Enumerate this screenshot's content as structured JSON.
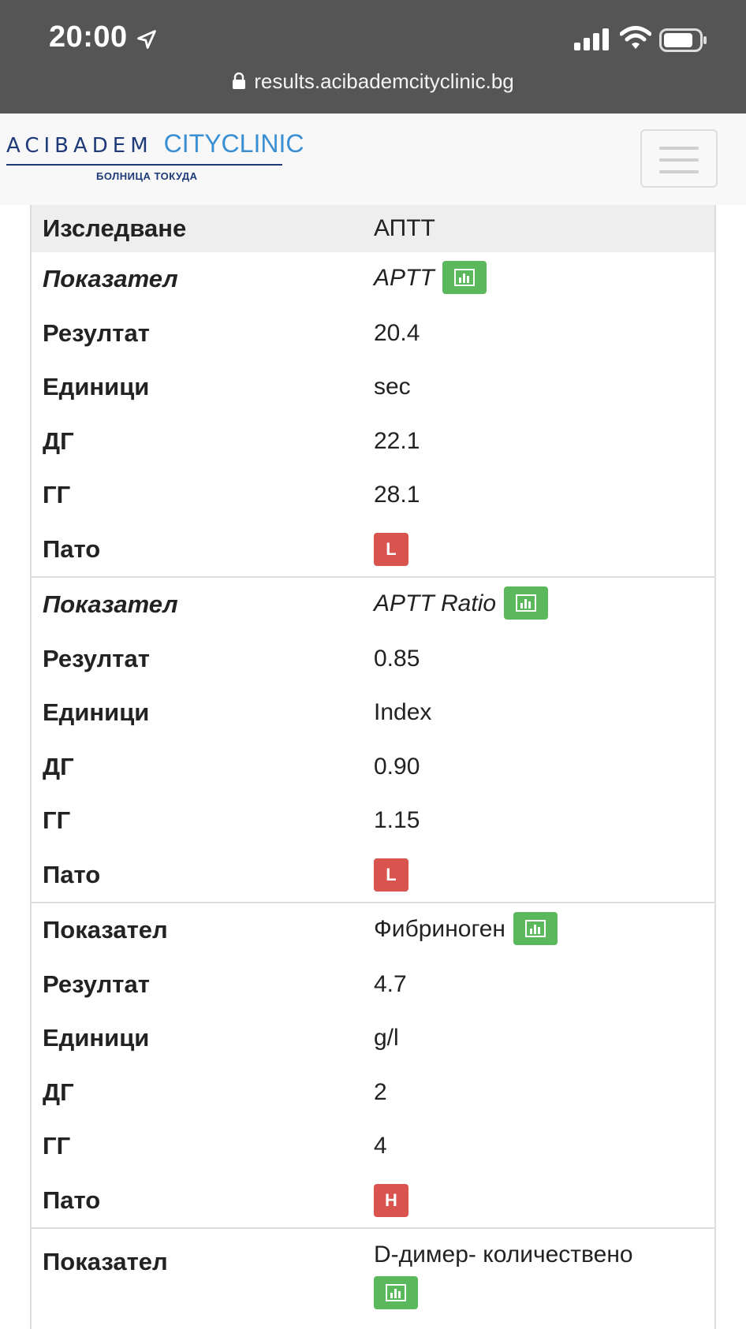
{
  "status_bar": {
    "time": "20:00",
    "url": "results.acibademcityclinic.bg"
  },
  "header": {
    "logo_main": "ACIBADEM",
    "logo_city": "CITYCLINIC",
    "logo_sub": "БОЛНИЦА ТОКУДА"
  },
  "table": {
    "study_label": "Изследване",
    "study_value": "АПТТ",
    "groups": [
      {
        "indicator_label": "Показател",
        "indicator": "APTT",
        "result_label": "Резултат",
        "result": "20.4",
        "units_label": "Единици",
        "units": "sec",
        "low_label": "ДГ",
        "low": "22.1",
        "high_label": "ГГ",
        "high": "28.1",
        "path_label": "Пато",
        "path": "L"
      },
      {
        "indicator_label": "Показател",
        "indicator": "APTT Ratio",
        "result_label": "Резултат",
        "result": "0.85",
        "units_label": "Единици",
        "units": "Index",
        "low_label": "ДГ",
        "low": "0.90",
        "high_label": "ГГ",
        "high": "1.15",
        "path_label": "Пато",
        "path": "L"
      },
      {
        "indicator_label": "Показател",
        "indicator": "Фибриноген",
        "result_label": "Резултат",
        "result": "4.7",
        "units_label": "Единици",
        "units": "g/l",
        "low_label": "ДГ",
        "low": "2",
        "high_label": "ГГ",
        "high": "4",
        "path_label": "Пато",
        "path": "H"
      },
      {
        "indicator_label": "Показател",
        "indicator": "D-димер- количествено"
      }
    ]
  },
  "colors": {
    "chart_button": "#5cb85c",
    "path_badge": "#d9534f",
    "status_bar": "#555555"
  },
  "icons": {
    "chart": "bar-chart-icon",
    "lock": "lock-icon",
    "menu": "hamburger-icon"
  }
}
